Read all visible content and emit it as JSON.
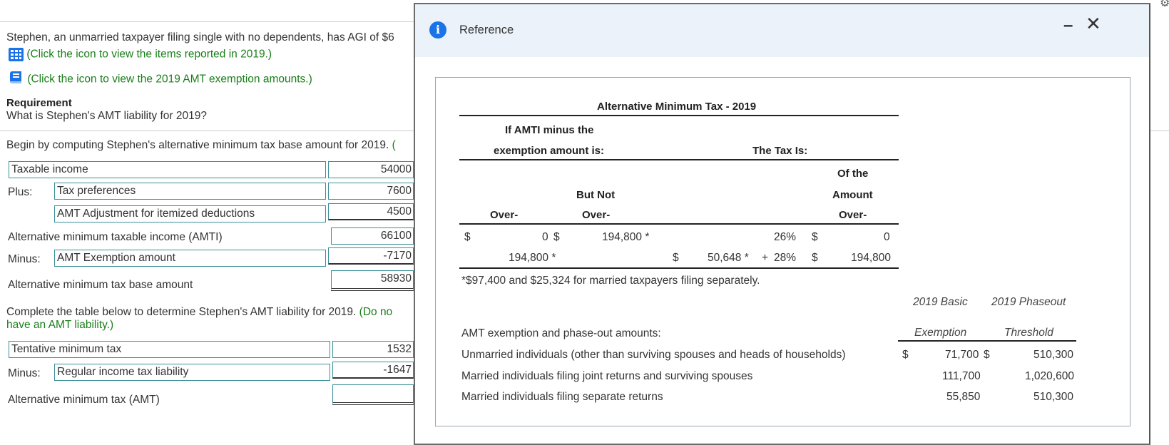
{
  "problem": {
    "intro": "Stephen, an unmarried taxpayer filing single with no dependents, has AGI of $6",
    "link1": "(Click the icon to view the items reported in 2019.)",
    "link2": "(Click the icon to view the 2019 AMT exemption amounts.)",
    "requirement_head": "Requirement",
    "requirement_text": "What is Stephen's AMT liability for 2019?",
    "begin_text": "Begin by computing Stephen's alternative minimum tax base amount for 2019.",
    "begin_tail": "("
  },
  "base_table": {
    "taxable_income_label": "Taxable income",
    "taxable_income_value": "54000",
    "plus_label": "Plus:",
    "tax_pref_label": "Tax preferences",
    "tax_pref_value": "7600",
    "amt_adj_label": "AMT Adjustment for itemized deductions",
    "amt_adj_value": "4500",
    "amti_label": "Alternative minimum taxable income (AMTI)",
    "amti_value": "66100",
    "minus_label": "Minus:",
    "exemption_label": "AMT Exemption amount",
    "exemption_value": "-7170",
    "base_label": "Alternative minimum tax base amount",
    "base_value": "58930"
  },
  "complete": {
    "text": "Complete the table below to determine Stephen's AMT liability for 2019.",
    "green_tail": "(Do no",
    "green_line2": "have an AMT liability.)"
  },
  "liability_table": {
    "tentative_label": "Tentative minimum tax",
    "tentative_value": "1532",
    "minus_label": "Minus:",
    "regular_label": "Regular income tax liability",
    "regular_value": "-1647",
    "amt_label": "Alternative minimum tax (AMT)",
    "amt_value": ""
  },
  "modal": {
    "title": "Reference",
    "minimize": "–",
    "close": "✕",
    "table_title": "Alternative Minimum Tax - 2019",
    "hdr_if1": "If AMTI minus the",
    "hdr_if2": "exemption amount is:",
    "hdr_tax": "The Tax Is:",
    "hdr_of": "Of the",
    "hdr_amount": "Amount",
    "hdr_over3": "Over-",
    "hdr_butnot": "But Not",
    "hdr_over1": "Over-",
    "hdr_over2": "Over-",
    "rows": [
      {
        "d1": "$",
        "over": "0",
        "d2": "$",
        "butnot": "194,800 *",
        "d3": "",
        "base": "",
        "plus": "",
        "pct": "26%",
        "d4": "$",
        "of": "0"
      },
      {
        "d1": "",
        "over": "194,800 *",
        "d2": "",
        "butnot": "",
        "d3": "$",
        "base": "50,648 *",
        "plus": "+",
        "pct": "28%",
        "d4": "$",
        "of": "194,800"
      }
    ],
    "footnote": "*$97,400 and $25,324 for married taxpayers filing separately.",
    "exempt_hdr_basic1": "2019 Basic",
    "exempt_hdr_basic2": "Exemption",
    "exempt_hdr_phase1": "2019 Phaseout",
    "exempt_hdr_phase2": "Threshold",
    "exempt_title": "AMT exemption and phase-out amounts:",
    "exempt_rows": [
      {
        "label": "Unmarried individuals (other than surviving spouses and heads of households)",
        "d1": "$",
        "basic": "71,700",
        "d2": "$",
        "phase": "510,300"
      },
      {
        "label": "Married individuals filing joint returns and surviving spouses",
        "d1": "",
        "basic": "111,700",
        "d2": "",
        "phase": "1,020,600"
      },
      {
        "label": "Married individuals filing separate returns",
        "d1": "",
        "basic": "55,850",
        "d2": "",
        "phase": "510,300"
      }
    ]
  },
  "colors": {
    "accent": "#1a7f1a",
    "field_border": "#3a8f98",
    "info_icon": "#1b73e8",
    "modal_header": "#ebf2f9"
  }
}
